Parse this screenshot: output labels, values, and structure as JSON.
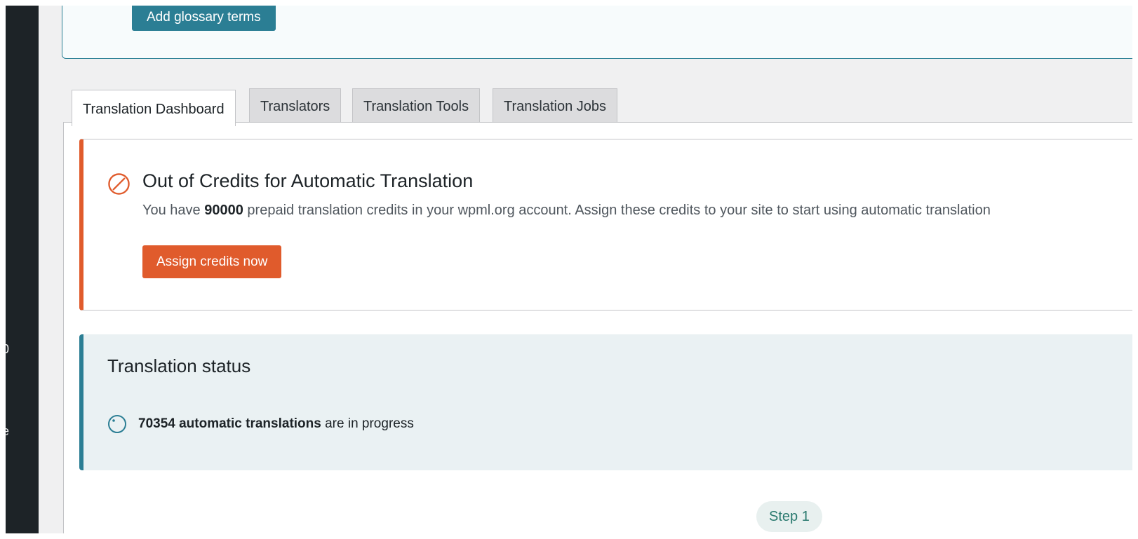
{
  "sidebar": {
    "fragments": [
      "0",
      "e"
    ]
  },
  "glossary": {
    "button_label": "Add glossary terms"
  },
  "tabs": [
    {
      "label": "Translation Dashboard",
      "active": true
    },
    {
      "label": "Translators",
      "active": false
    },
    {
      "label": "Translation Tools",
      "active": false
    },
    {
      "label": "Translation Jobs",
      "active": false
    }
  ],
  "credit_notice": {
    "icon": "ban-icon",
    "title": "Out of Credits for Automatic Translation",
    "text_before": "You have ",
    "credits": "90000",
    "text_after": " prepaid translation credits in your wpml.org account. Assign these credits to your site to start using automatic translation",
    "button_label": "Assign credits now",
    "accent_color": "#e05b2c"
  },
  "translation_status": {
    "title": "Translation status",
    "icon": "progress-circle-icon",
    "count_label": "70354 automatic translations",
    "suffix": " are in progress",
    "accent_color": "#2b7e94"
  },
  "wizard": {
    "step_label": "Step 1"
  }
}
